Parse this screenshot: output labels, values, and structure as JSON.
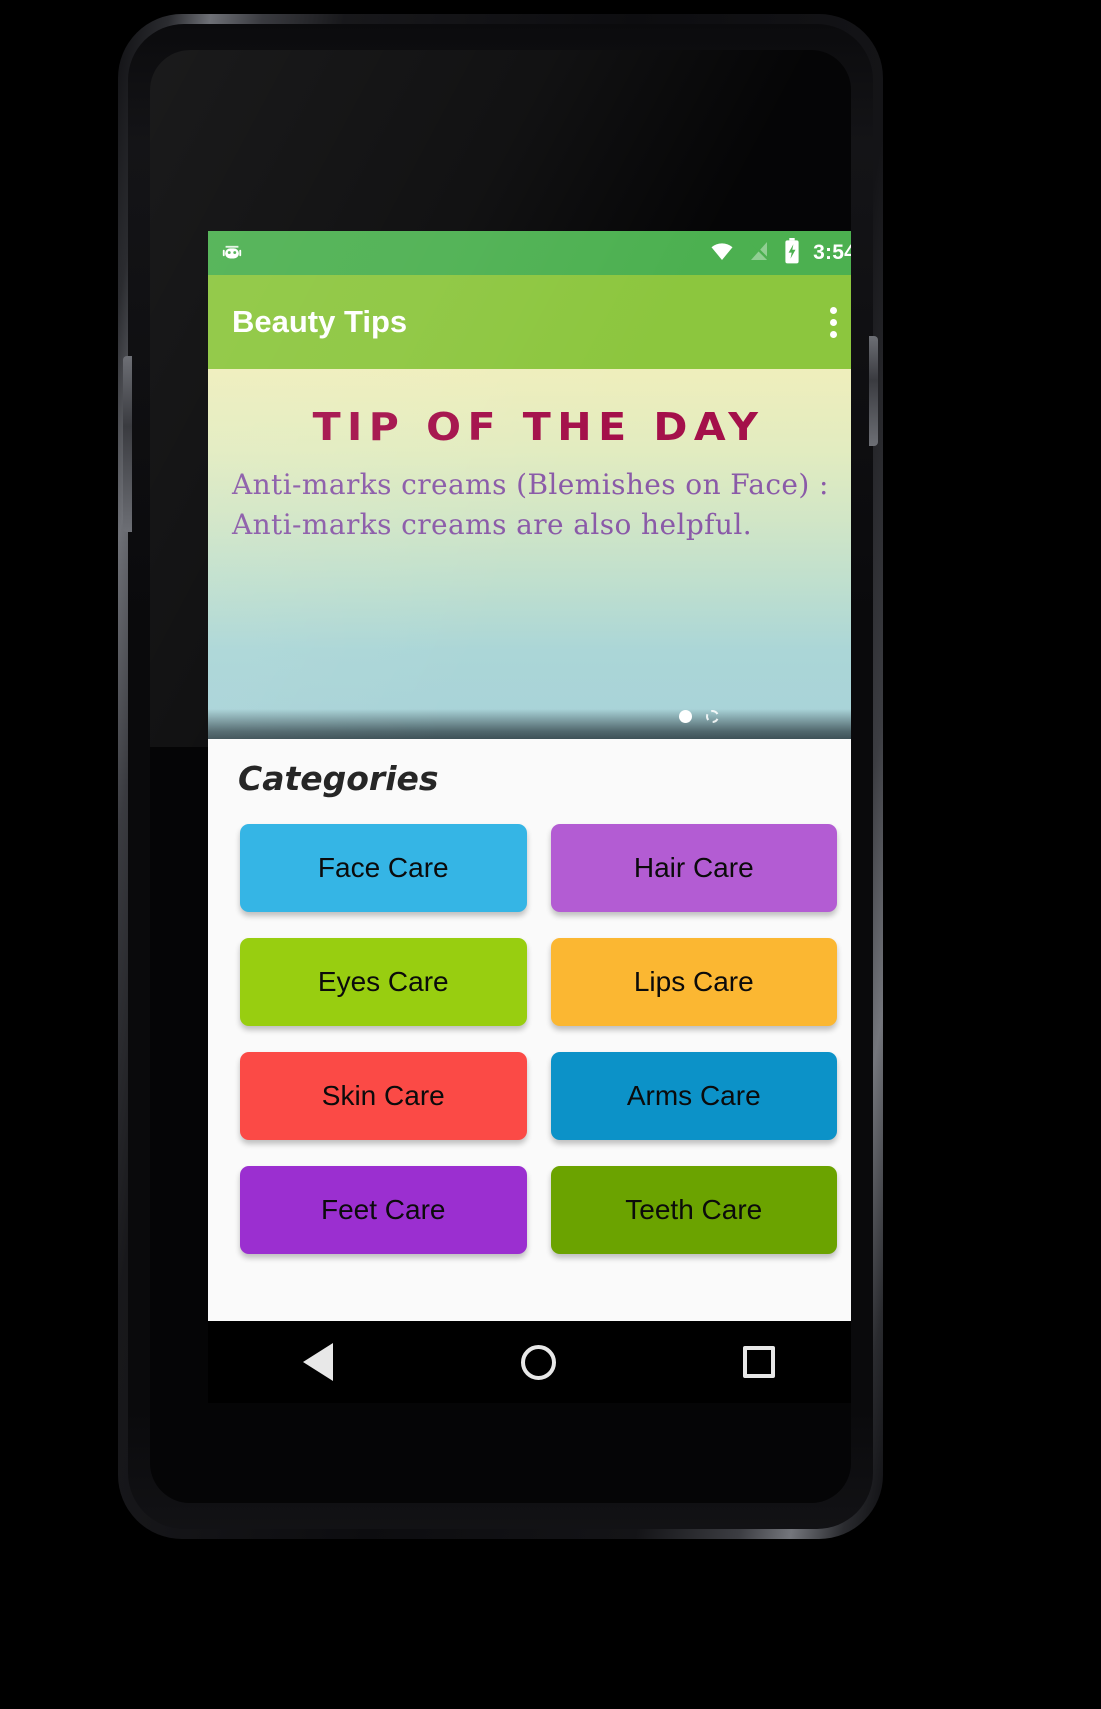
{
  "status_bar": {
    "left_icon": "android-mascot-icon",
    "icons": [
      "wifi-icon",
      "signal-off-icon",
      "battery-charging-icon"
    ],
    "time": "3:54",
    "background_color": "#4cb050"
  },
  "app_bar": {
    "title": "Beauty Tips",
    "overflow_label": "overflow-menu",
    "background_color": "#8cc63e"
  },
  "tip_banner": {
    "title": "TIP OF THE DAY",
    "text": "Anti-marks creams (Blemishes on Face) : Anti-marks creams are also helpful.",
    "title_color": "#a4104a",
    "text_color": "#8a5aa8",
    "pager": {
      "total": 2,
      "current": 1
    }
  },
  "categories": {
    "heading": "Categories",
    "items": [
      {
        "label": "Face Care",
        "color": "#35b5e5"
      },
      {
        "label": "Hair Care",
        "color": "#b35cd3"
      },
      {
        "label": "Eyes Care",
        "color": "#98ce10"
      },
      {
        "label": "Lips Care",
        "color": "#fbb732"
      },
      {
        "label": "Skin Care",
        "color": "#fb4a46"
      },
      {
        "label": "Arms Care",
        "color": "#0c92c8"
      },
      {
        "label": "Feet Care",
        "color": "#9b2fd0"
      },
      {
        "label": "Teeth Care",
        "color": "#6ba300"
      }
    ]
  },
  "nav_bar": {
    "back": "back-button",
    "home": "home-button",
    "recents": "recents-button"
  }
}
